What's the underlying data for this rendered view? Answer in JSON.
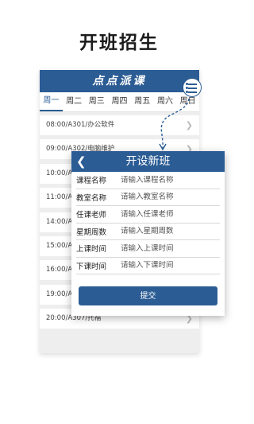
{
  "promo": {
    "title": "开班招生"
  },
  "app": {
    "title": "点点派课"
  },
  "week_tabs": [
    "周一",
    "周二",
    "周三",
    "周四",
    "周五",
    "周六",
    "周日"
  ],
  "active_tab": 0,
  "courses": [
    "08:00/A301/办公软件",
    "09:00/A302/电脑维护",
    "10:00/A3",
    "11:00/A3",
    "14:00/A3",
    "15:00/A3",
    "16:00/A3",
    "19:00/A3",
    "20:00/A307/托福"
  ],
  "dialog": {
    "title": "开设新班",
    "back_icon": "chevron-left-icon",
    "fields": [
      {
        "label": "课程名称",
        "placeholder": "请输入课程名称"
      },
      {
        "label": "教室名称",
        "placeholder": "请输入教室名称"
      },
      {
        "label": "任课老师",
        "placeholder": "请输入任课老师"
      },
      {
        "label": "星期周数",
        "placeholder": "请输入星期周数"
      },
      {
        "label": "上课时间",
        "placeholder": "请输入上课时间"
      },
      {
        "label": "下课时间",
        "placeholder": "请输入下课时间"
      }
    ],
    "submit": "提交"
  },
  "colors": {
    "primary": "#2b5c94",
    "background": "#eeeeee"
  }
}
